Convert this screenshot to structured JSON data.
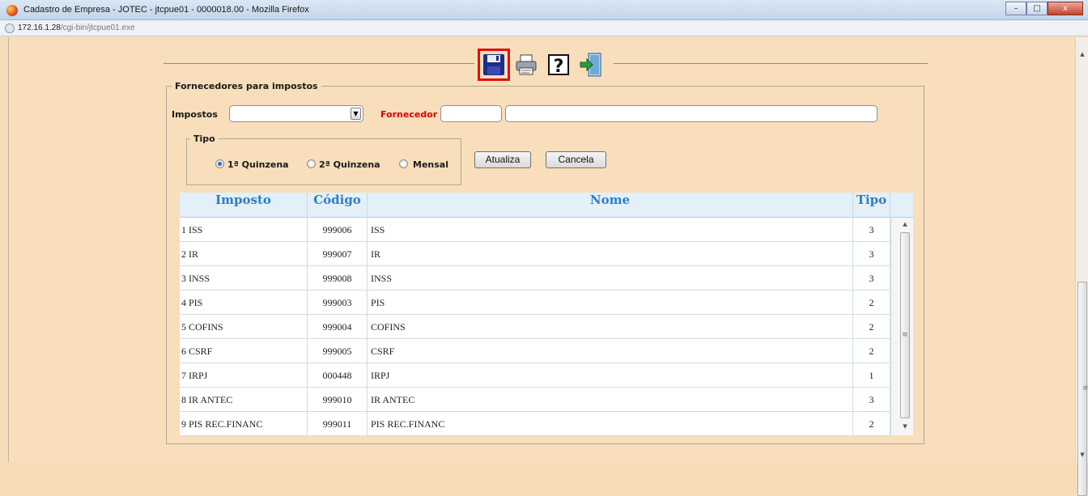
{
  "window": {
    "title": "Cadastro de Empresa - JOTEC - jtcpue01 - 0000018.00 - Mozilla Firefox",
    "btn_min": "–",
    "btn_max": "□",
    "btn_close": "x"
  },
  "address": {
    "host": "172.16.1.28",
    "path": "/cgi-bin/jtcpue01.exe"
  },
  "toolbar": {
    "icons": [
      "save-icon",
      "print-icon",
      "help-icon",
      "exit-icon"
    ],
    "selected": "save-icon"
  },
  "form": {
    "legend": "Fornecedores para impostos",
    "impostos_label": "Impostos",
    "impostos_value": "",
    "fornecedor_label": "Fornecedor",
    "fornecedor_code": "",
    "fornecedor_name": "",
    "tipo_legend": "Tipo",
    "tipo_options": [
      "1ª Quinzena",
      "2ª Quinzena",
      "Mensal"
    ],
    "tipo_selected": "1ª Quinzena",
    "atualiza_label": "Atualiza",
    "cancela_label": "Cancela"
  },
  "table": {
    "headers": [
      "Imposto",
      "Código",
      "Nome",
      "Tipo"
    ],
    "rows": [
      [
        "1 ISS",
        "999006",
        "ISS",
        "3"
      ],
      [
        "2 IR",
        "999007",
        "IR",
        "3"
      ],
      [
        "3 INSS",
        "999008",
        "INSS",
        "3"
      ],
      [
        "4 PIS",
        "999003",
        "PIS",
        "2"
      ],
      [
        "5 COFINS",
        "999004",
        "COFINS",
        "2"
      ],
      [
        "6 CSRF",
        "999005",
        "CSRF",
        "2"
      ],
      [
        "7 IRPJ",
        "000448",
        "IRPJ",
        "1"
      ],
      [
        "8 IR ANTEC",
        "999010",
        "IR ANTEC",
        "3"
      ],
      [
        "9 PIS REC.FINANC",
        "999011",
        "PIS REC.FINANC",
        "2"
      ]
    ]
  },
  "colors": {
    "page_bg": "#f8deba",
    "header_text": "#2d7fc4",
    "fornecedor_label": "#e00000",
    "selected_tool_border": "#e01010"
  }
}
